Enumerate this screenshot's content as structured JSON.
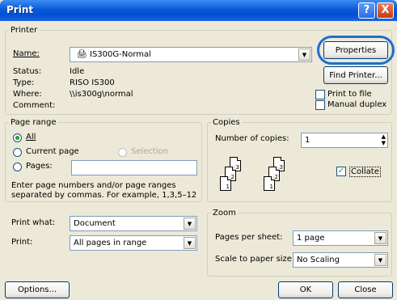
{
  "window": {
    "title": "Print",
    "help_label": "?",
    "close_label": "X"
  },
  "printer": {
    "legend": "Printer",
    "name_label": "Name:",
    "name_value": "IS300G-Normal",
    "status_label": "Status:",
    "status_value": "Idle",
    "type_label": "Type:",
    "type_value": "RISO IS300",
    "where_label": "Where:",
    "where_value": "\\\\is300g\\normal",
    "comment_label": "Comment:",
    "properties_label": "Properties",
    "find_label": "Find Printer...",
    "print_to_file_label": "Print to file",
    "manual_duplex_label": "Manual duplex"
  },
  "page_range": {
    "legend": "Page range",
    "all_label": "All",
    "current_label": "Current page",
    "selection_label": "Selection",
    "pages_label": "Pages:",
    "help_line1": "Enter page numbers and/or page ranges",
    "help_line2": "separated by commas.  For example, 1,3,5–12"
  },
  "copies": {
    "legend": "Copies",
    "number_label": "Number of copies:",
    "number_value": "1",
    "collate_label": "Collate",
    "page_icons": [
      "3",
      "2",
      "1",
      "3",
      "2",
      "1"
    ]
  },
  "print_what": {
    "label": "Print what:",
    "value": "Document"
  },
  "print_subset": {
    "label": "Print:",
    "value": "All pages in range"
  },
  "zoom": {
    "legend": "Zoom",
    "pages_per_sheet_label": "Pages per sheet:",
    "pages_per_sheet_value": "1 page",
    "scale_label": "Scale to paper size:",
    "scale_value": "No Scaling"
  },
  "footer": {
    "options_label": "Options...",
    "ok_label": "OK",
    "close_label": "Close"
  },
  "colors": {
    "title_bar": "#0a5ad6",
    "highlight": "#1c6fd0",
    "dialog_bg": "#ece9d8"
  }
}
